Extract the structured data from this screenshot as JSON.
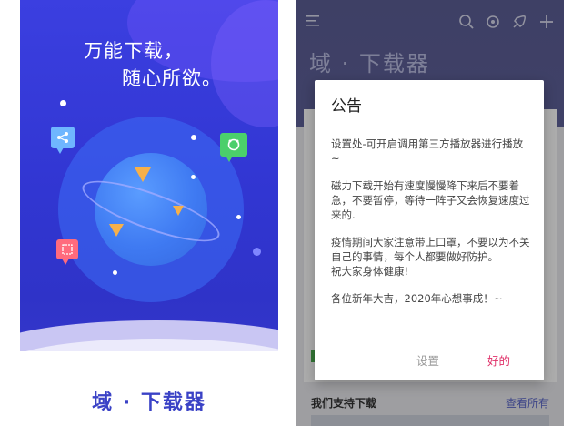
{
  "splash": {
    "slogan_line1": "万能下载，",
    "slogan_line2": "随心所欲。",
    "brand": "域 · 下载器"
  },
  "app": {
    "title": "域 · 下载器",
    "toolbar_icons": [
      "menu-icon",
      "search-icon",
      "refresh-icon",
      "rocket-icon",
      "add-icon"
    ],
    "section_title": "我们支持下载",
    "section_link": "查看所有"
  },
  "dialog": {
    "title": "公告",
    "paragraphs": [
      "设置处-可开启调用第三方播放器进行播放~",
      "磁力下载开始有速度慢慢降下来后不要着急，不要暂停，等待一阵子又会恢复速度过来的.",
      "疫情期间大家注意带上口罩，不要以为不关自己的事情，每个人都要做好防护。",
      "祝大家身体健康!",
      "各位新年大吉，2020年心想事成！~"
    ],
    "btn_settings": "设置",
    "btn_ok": "好的"
  },
  "colors": {
    "splash_bg": "#3136d2",
    "brand_text": "#3a42c6",
    "app_header": "#5c5f96",
    "ok_button": "#e0326a",
    "settings_button": "#9a9a9a"
  }
}
